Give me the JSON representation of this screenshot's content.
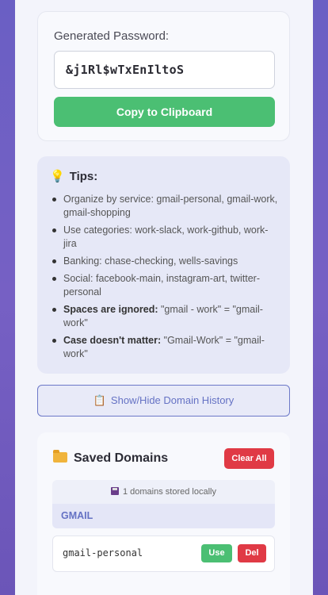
{
  "generator": {
    "label": "Generated Password:",
    "password": "&j1Rl$wTxEnIltoS",
    "copy_label": "Copy to Clipboard"
  },
  "tips": {
    "icon": "lightbulb-icon",
    "title": "Tips:",
    "items": [
      {
        "bold": "",
        "text": "Organize by service: gmail-personal, gmail-work, gmail-shopping"
      },
      {
        "bold": "",
        "text": "Use categories: work-slack, work-github, work-jira"
      },
      {
        "bold": "",
        "text": "Banking: chase-checking, wells-savings"
      },
      {
        "bold": "",
        "text": "Social: facebook-main, instagram-art, twitter-personal"
      },
      {
        "bold": "Spaces are ignored:",
        "text": " \"gmail - work\" = \"gmail-work\""
      },
      {
        "bold": "Case doesn't matter:",
        "text": " \"Gmail-Work\" = \"gmail-work\""
      }
    ]
  },
  "history": {
    "icon": "clipboard-icon",
    "label": "Show/Hide Domain History"
  },
  "saved": {
    "icon": "folder-icon",
    "title": "Saved Domains",
    "clear_label": "Clear All",
    "count_icon": "floppy-disk-icon",
    "count_text": "1 domains stored locally",
    "groups": [
      {
        "name": "GMAIL",
        "domains": [
          {
            "name": "gmail-personal",
            "use_label": "Use",
            "del_label": "Del"
          }
        ]
      }
    ]
  },
  "colors": {
    "background": "#6a5fc4",
    "success": "#4bbf73",
    "danger": "#e03a45",
    "accent": "#6572c4"
  }
}
